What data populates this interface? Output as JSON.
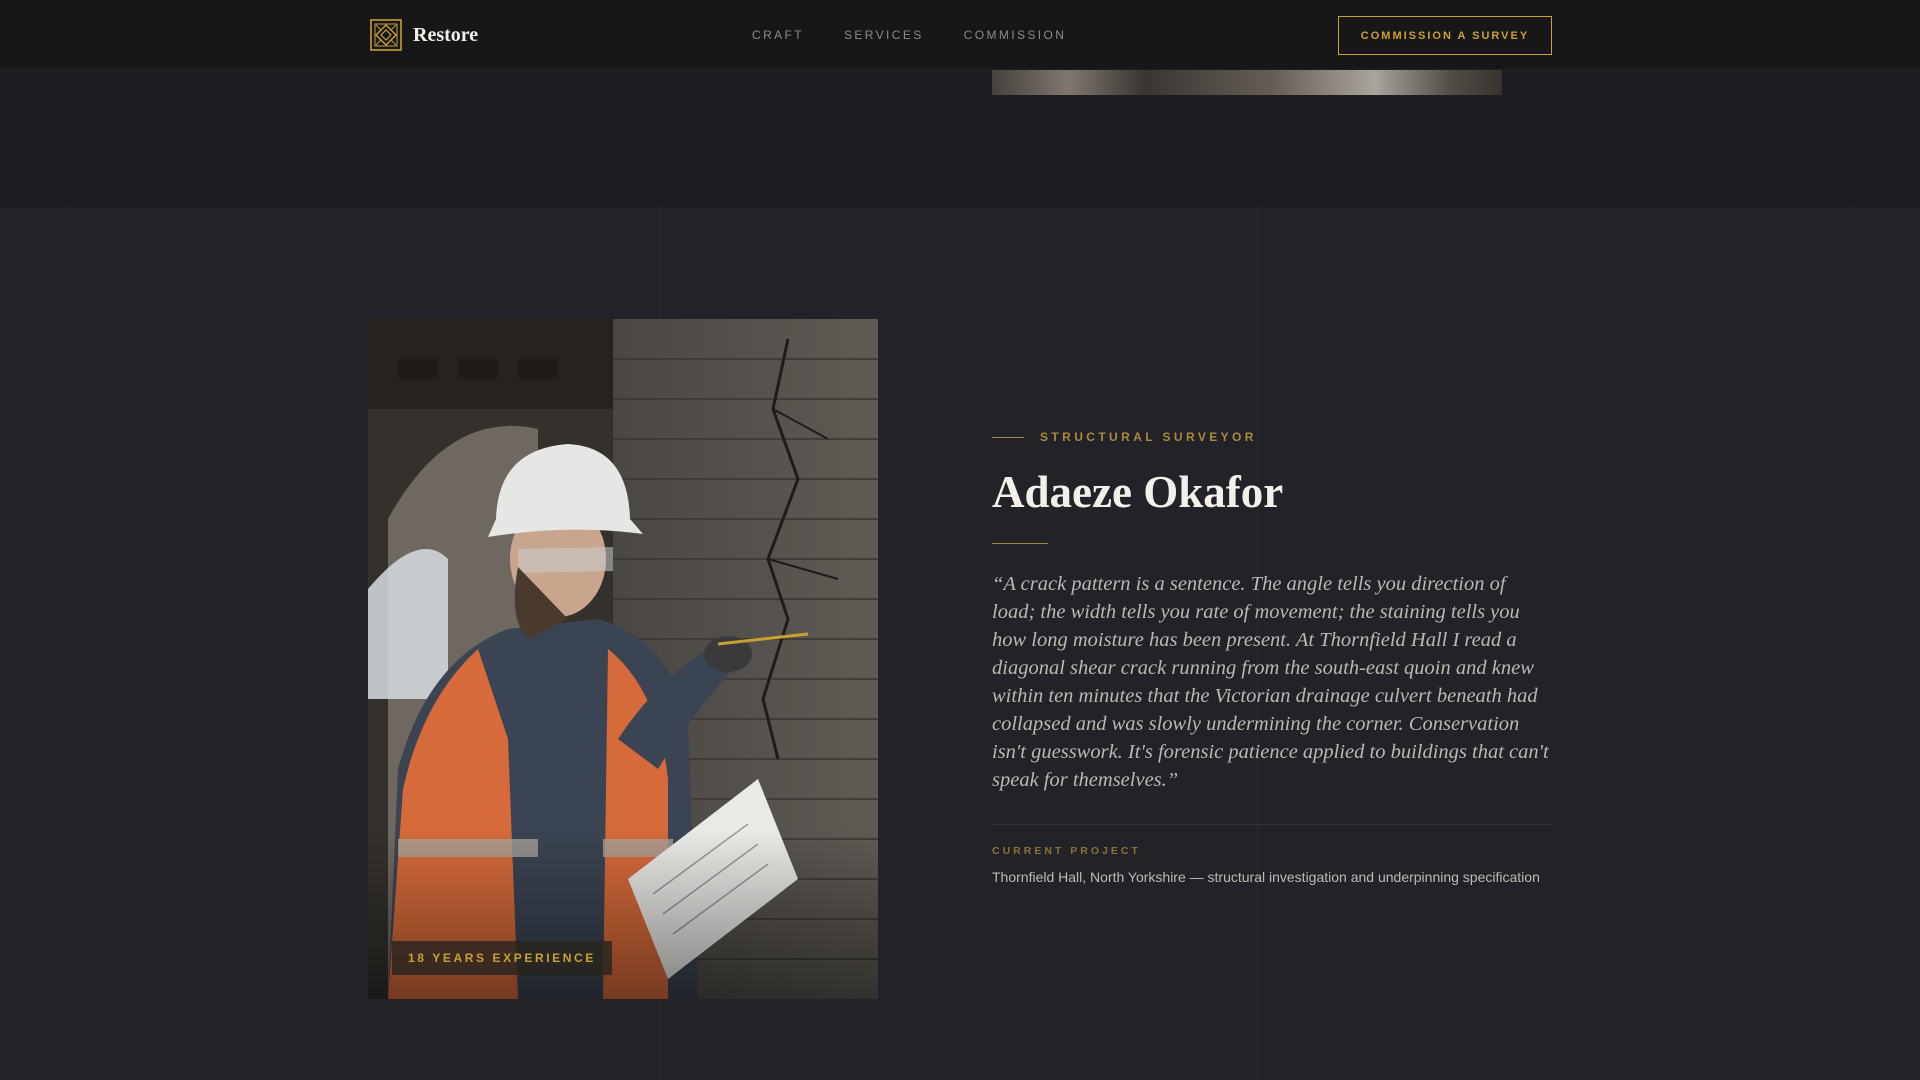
{
  "brand": {
    "name": "Restore",
    "logo_icon": "ornamental-lattice-icon",
    "accent_color": "#c9a033"
  },
  "nav": {
    "links": [
      "CRAFT",
      "SERVICES",
      "COMMISSION"
    ],
    "cta_label": "COMMISSION A SURVEY"
  },
  "profile": {
    "role": "STRUCTURAL SURVEYOR",
    "name": "Adaeze Okafor",
    "quote": "“A crack pattern is a sentence. The angle tells you direction of load; the width tells you rate of movement; the staining tells you how long moisture has been present. At Thornfield Hall I read a diagonal shear crack running from the south-east quoin and knew within ten minutes that the Victorian drainage culvert beneath had collapsed and was slowly undermining the corner. Conservation isn't guesswork. It's forensic patience applied to buildings that can't speak for themselves.”",
    "experience_badge": "18 YEARS EXPERIENCE",
    "current_project_label": "CURRENT PROJECT",
    "current_project": "Thornfield Hall, North Yorkshire — structural investigation and underpinning specification"
  }
}
